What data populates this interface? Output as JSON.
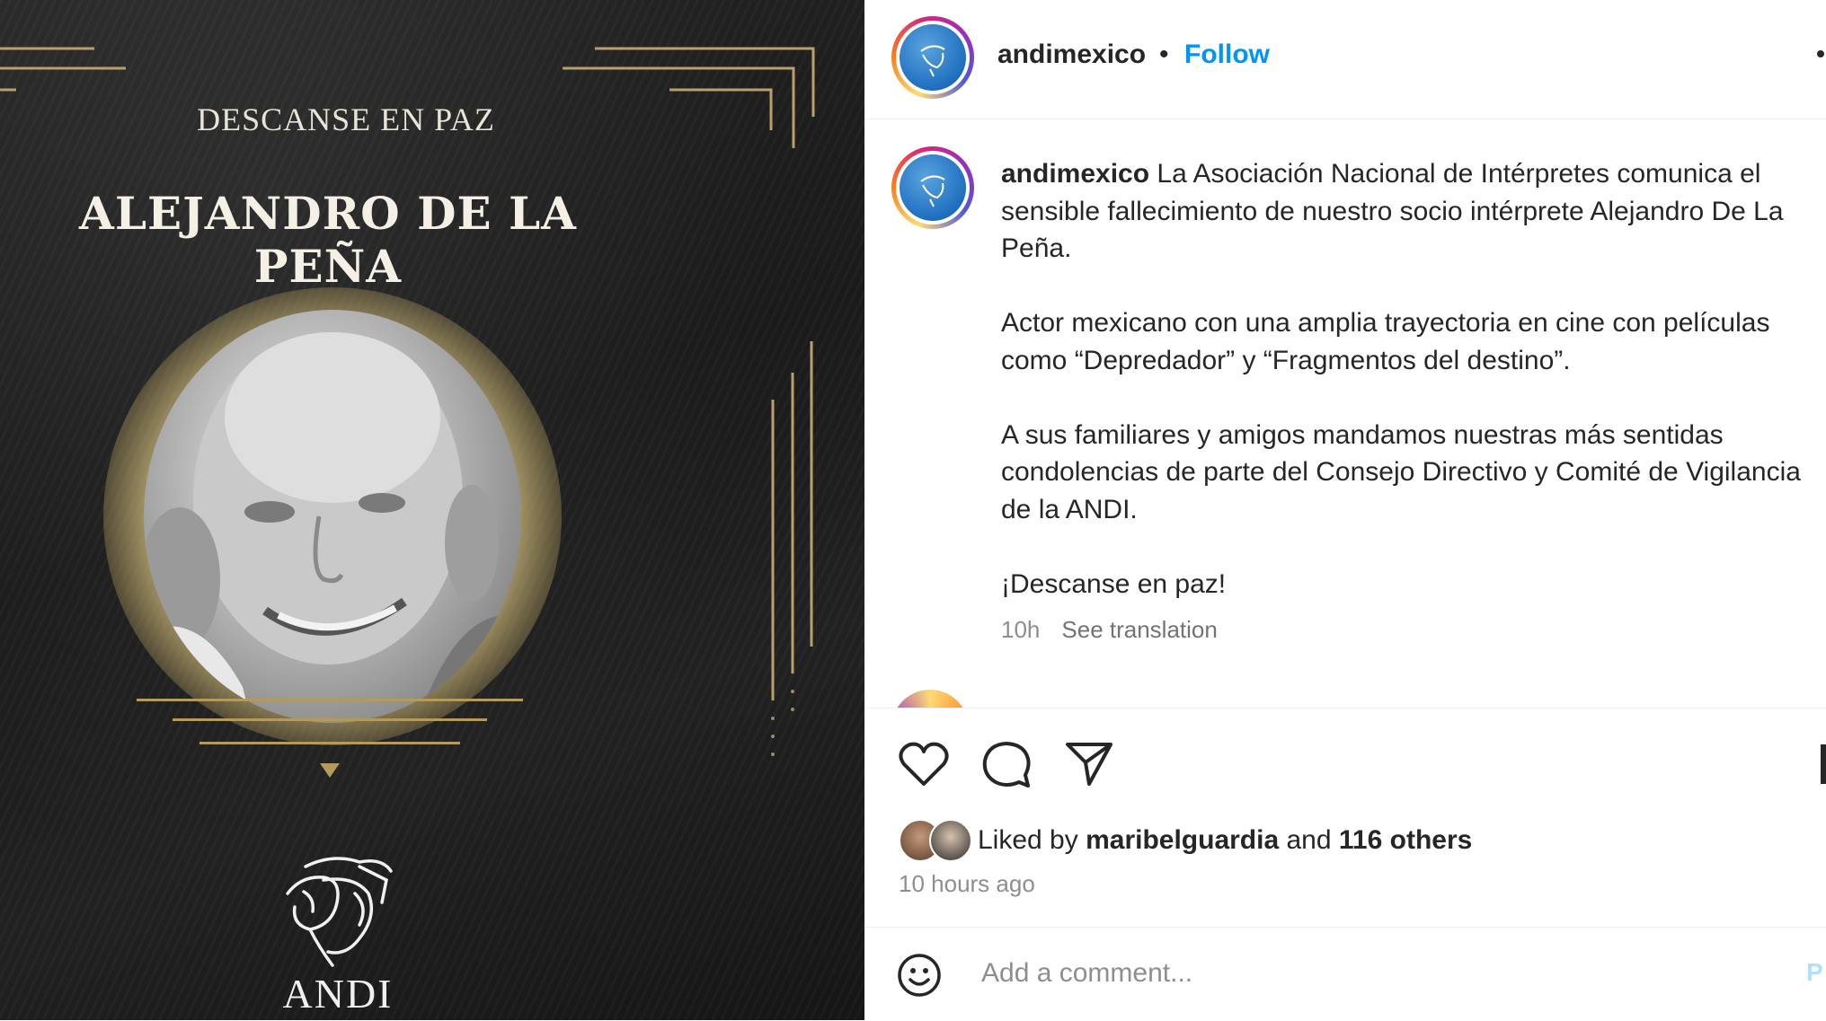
{
  "image": {
    "header_small": "DESCANSE EN PAZ",
    "name": "ALEJANDRO DE LA PEÑA",
    "logo_text": "ANDI"
  },
  "header": {
    "username": "andimexico",
    "separator": "•",
    "follow_label": "Follow"
  },
  "caption": {
    "username": "andimexico",
    "paragraphs": [
      " La Asociación Nacional de Intérpretes comunica el sensible fallecimiento de nuestro socio intérprete Alejandro De La Peña.",
      "Actor mexicano con una amplia trayectoria en cine con películas como “Depredador” y “Fragmentos del destino”.",
      "A sus familiares y amigos mandamos nuestras más sentidas condolencias de parte del Consejo Directivo y Comité de Vigilancia de la ANDI.",
      "¡Descanse en paz!"
    ],
    "time": "10h",
    "translation_label": "See translation"
  },
  "actions": {
    "icons": [
      "heart-icon",
      "comment-icon",
      "share-icon",
      "bookmark-icon"
    ],
    "liked_by_prefix": "Liked by ",
    "liked_by_user": "maribelguardia",
    "liked_by_mid": " and ",
    "liked_by_others": "116 others",
    "time_ago": "10 hours ago"
  },
  "comment": {
    "placeholder": "Add a comment...",
    "post_label": "P"
  },
  "colors": {
    "link_blue": "#0095f6",
    "gold": "#b59a5c",
    "muted": "#8e8e8e"
  }
}
